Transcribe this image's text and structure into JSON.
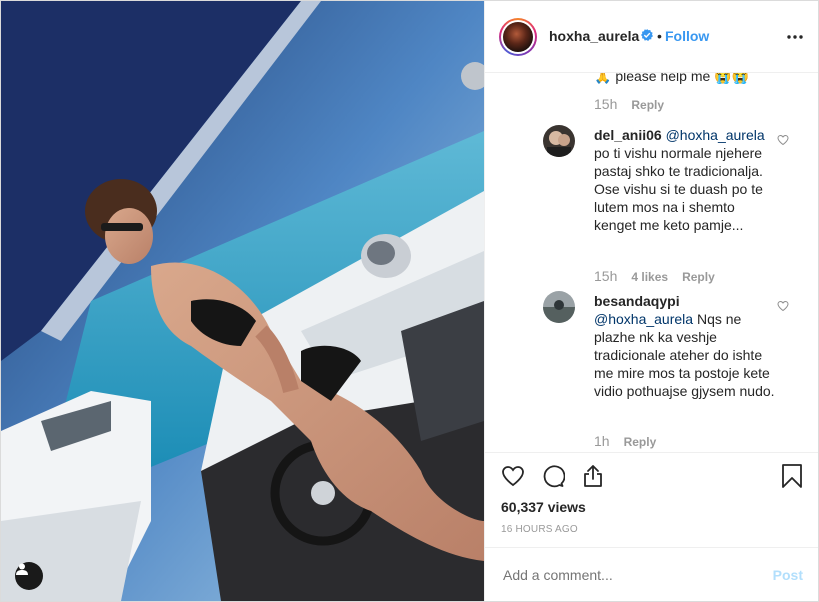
{
  "header": {
    "username": "hoxha_aurela",
    "separator": "•",
    "follow_label": "Follow"
  },
  "comments": [
    {
      "text": "🙏 please help me 😭😭",
      "time": "15h",
      "reply": "Reply"
    },
    {
      "username": "del_anii06",
      "mention": "@hoxha_aurela",
      "text": "po ti vishu normale njehere pastaj shko te tradicionalja. Ose vishu si te duash po te lutem mos na i shemto kenget me keto pamje...",
      "time": "15h",
      "likes": "4 likes",
      "reply": "Reply"
    },
    {
      "username": "besandaqypi",
      "mention": "@hoxha_aurela",
      "text": "Nqs ne plazhe nk ka veshje tradicionale ateher do ishte me mire mos ta postoje kete vidio pothuajse gjysem nudo.",
      "time": "1h",
      "reply": "Reply"
    }
  ],
  "stats": {
    "views": "60,337 views",
    "time_ago": "16 HOURS AGO"
  },
  "add_comment": {
    "placeholder": "Add a comment...",
    "post_label": "Post"
  },
  "colors": {
    "accent": "#3897f0",
    "post_disabled": "#b2dffc",
    "meta": "#999999"
  },
  "icons": [
    "user-tag-icon",
    "verified-icon",
    "more-icon",
    "heart-icon",
    "comment-icon",
    "share-icon",
    "bookmark-icon"
  ]
}
